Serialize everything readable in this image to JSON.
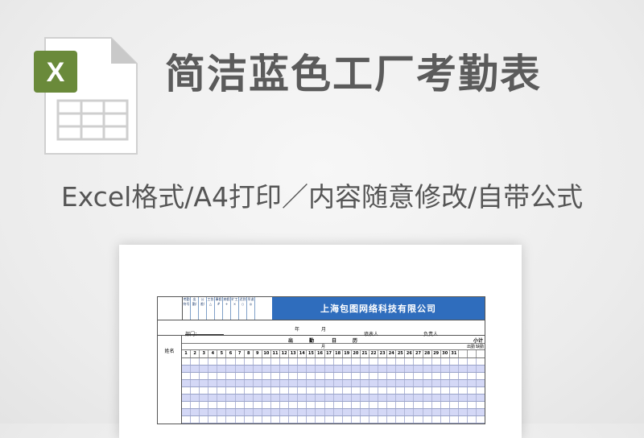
{
  "title": "简洁蓝色工厂考勤表",
  "subtitle": "Excel格式/A4打印／内容随意修改/自带公式",
  "icon": {
    "name": "excel-file-icon",
    "badge_letter": "X",
    "badge_color": "#6a8a3a"
  },
  "sheet": {
    "company": "上海包图网络科技有限公司",
    "legend_cols": [
      "考勤符号",
      "出勤/",
      "公差/",
      "工伤△",
      "事假#",
      "病假+",
      "旷工×",
      "迟到○",
      "早退◎"
    ],
    "info": {
      "dept_label": "部门：",
      "year_label": "年",
      "month_label": "月",
      "filler_label": "填表人",
      "manager_label": "负责人"
    },
    "name_header": "姓名",
    "attendance_header": [
      "出",
      "勤",
      "日",
      "历"
    ],
    "month_sub": "月",
    "subtotal_header": "小计",
    "attend_header": "出勤",
    "absent_header": "缺勤",
    "days": [
      "1",
      "2",
      "3",
      "4",
      "5",
      "6",
      "7",
      "8",
      "9",
      "10",
      "11",
      "12",
      "13",
      "14",
      "15",
      "16",
      "17",
      "18",
      "19",
      "20",
      "21",
      "22",
      "23",
      "24",
      "25",
      "26",
      "27",
      "28",
      "29",
      "30",
      "31"
    ],
    "accent_color": "#2f6dbd",
    "stripe_color": "#d4d8f6"
  }
}
